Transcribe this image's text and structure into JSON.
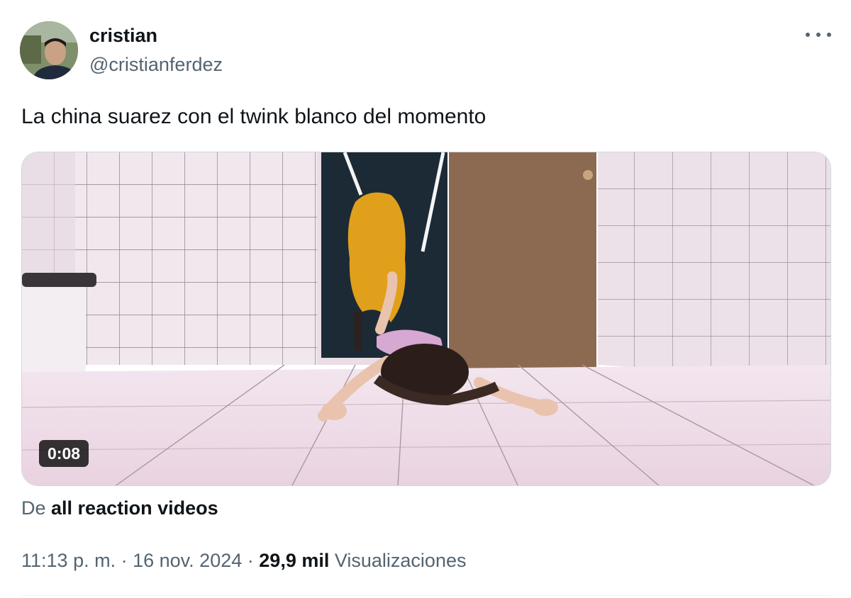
{
  "author": {
    "display_name": "cristian",
    "handle": "@cristianferdez"
  },
  "icons": {
    "more": "more-horizontal-icon"
  },
  "tweet": {
    "text": "La china suarez con el twink blanco del momento"
  },
  "media": {
    "duration": "0:08"
  },
  "source": {
    "prefix": "De",
    "name": "all reaction videos"
  },
  "meta": {
    "time": "11:13 p. m.",
    "separator": "·",
    "date": "16 nov. 2024",
    "views_count": "29,9 mil",
    "views_label": "Visualizaciones"
  },
  "colors": {
    "secondary_text": "#536471",
    "primary_text": "#0f1419",
    "border": "#cfd9de"
  }
}
